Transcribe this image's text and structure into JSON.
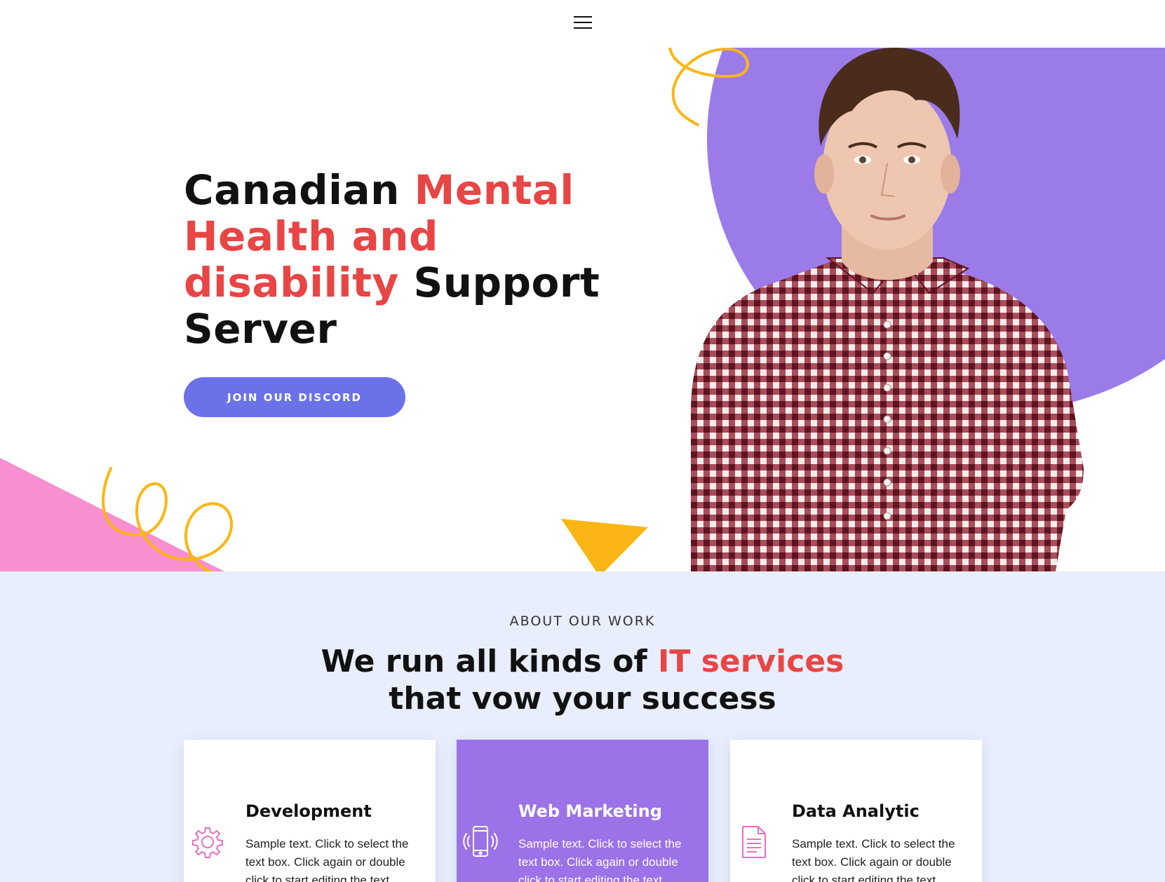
{
  "header": {
    "menu_icon": "hamburger-menu-icon"
  },
  "hero": {
    "title_part1": "Canadian ",
    "title_accent": "Mental Health and disability",
    "title_part2": " Support Server",
    "cta_label": "JOIN OUR DISCORD",
    "image": "man-in-checkered-shirt-photo"
  },
  "about": {
    "eyebrow": "ABOUT OUR WORK",
    "title_part1": "We run all kinds of ",
    "title_accent": "IT services",
    "title_part2": "that vow your success",
    "cards": [
      {
        "title": "Development",
        "icon": "gear-icon",
        "text": "Sample text. Click to select the text box. Click again or double click to start editing the text."
      },
      {
        "title": "Web Marketing",
        "icon": "smartphone-icon",
        "text": "Sample text. Click to select the text box. Click again or double click to start editing the text."
      },
      {
        "title": "Data Analytic",
        "icon": "document-icon",
        "text": "Sample text. Click to select the text box. Click again or double click to start editing the text."
      }
    ]
  },
  "colors": {
    "accent_red": "#e84545",
    "purple": "#9b7be8",
    "button_blue": "#6b72e8",
    "pink": "#f88fce",
    "yellow": "#fbb615",
    "section_bg": "#e8eefc"
  }
}
